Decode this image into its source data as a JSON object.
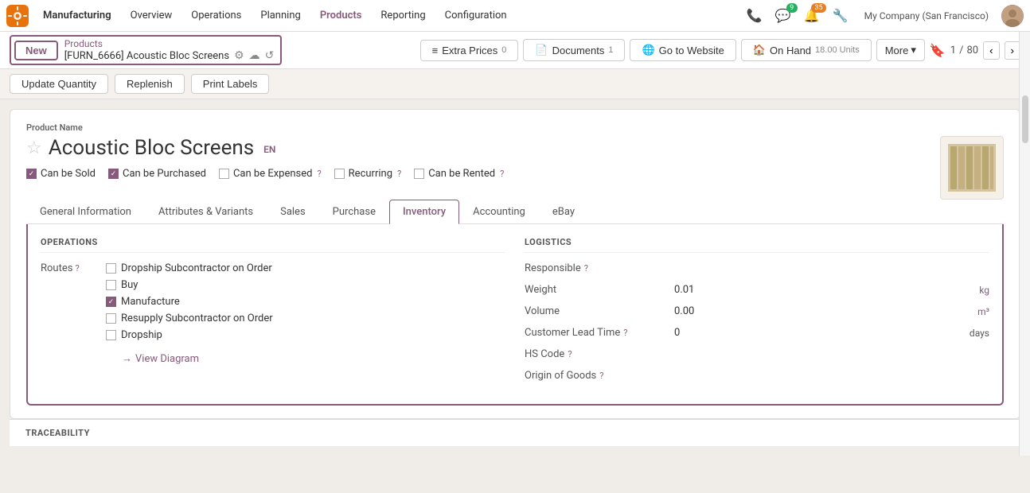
{
  "app": {
    "name": "Manufacturing"
  },
  "nav": {
    "items": [
      {
        "label": "Overview",
        "active": false
      },
      {
        "label": "Operations",
        "active": false
      },
      {
        "label": "Planning",
        "active": false
      },
      {
        "label": "Products",
        "active": true
      },
      {
        "label": "Reporting",
        "active": false
      },
      {
        "label": "Configuration",
        "active": false
      }
    ]
  },
  "header_icons": {
    "phone": "📞",
    "chat_badge": "9",
    "bell_badge": "35",
    "settings": "⚙",
    "company": "My Company (San Francisco)"
  },
  "breadcrumb": {
    "new_label": "New",
    "parent_label": "Products",
    "current": "[FURN_6666] Acoustic Bloc Screens"
  },
  "toolbar": {
    "extra_prices_label": "Extra Prices",
    "extra_prices_count": "0",
    "documents_label": "Documents",
    "documents_count": "1",
    "go_to_website_label": "Go to Website",
    "on_hand_label": "On Hand",
    "on_hand_value": "18.00 Units",
    "more_label": "More",
    "page_current": "1",
    "page_total": "80"
  },
  "sub_toolbar": {
    "update_qty_label": "Update Quantity",
    "replenish_label": "Replenish",
    "print_labels_label": "Print Labels"
  },
  "product": {
    "name_label": "Product Name",
    "name": "Acoustic Bloc Screens",
    "lang": "EN",
    "can_be_sold": true,
    "can_be_purchased": true,
    "can_be_expensed": false,
    "recurring": false,
    "can_be_rented": false
  },
  "tabs": [
    {
      "label": "General Information",
      "active": false
    },
    {
      "label": "Attributes & Variants",
      "active": false
    },
    {
      "label": "Sales",
      "active": false
    },
    {
      "label": "Purchase",
      "active": false
    },
    {
      "label": "Inventory",
      "active": true
    },
    {
      "label": "Accounting",
      "active": false
    },
    {
      "label": "eBay",
      "active": false
    }
  ],
  "inventory_tab": {
    "operations_section": "OPERATIONS",
    "logistics_section": "LOGISTICS",
    "routes_label": "Routes",
    "routes": [
      {
        "label": "Dropship Subcontractor on Order",
        "checked": false
      },
      {
        "label": "Buy",
        "checked": false
      },
      {
        "label": "Manufacture",
        "checked": true
      },
      {
        "label": "Resupply Subcontractor on Order",
        "checked": false
      },
      {
        "label": "Dropship",
        "checked": false
      }
    ],
    "view_diagram_label": "View Diagram",
    "logistics_fields": [
      {
        "label": "Responsible",
        "value": "",
        "unit": "",
        "has_help": true
      },
      {
        "label": "Weight",
        "value": "0.01",
        "unit": "kg",
        "has_help": false
      },
      {
        "label": "Volume",
        "value": "0.00",
        "unit": "m³",
        "has_help": false
      },
      {
        "label": "Customer Lead Time",
        "value": "0",
        "unit": "days",
        "has_help": true
      },
      {
        "label": "HS Code",
        "value": "",
        "unit": "",
        "has_help": true
      },
      {
        "label": "Origin of Goods",
        "value": "",
        "unit": "",
        "has_help": true
      }
    ]
  },
  "traceability": {
    "label": "TRACEABILITY"
  }
}
